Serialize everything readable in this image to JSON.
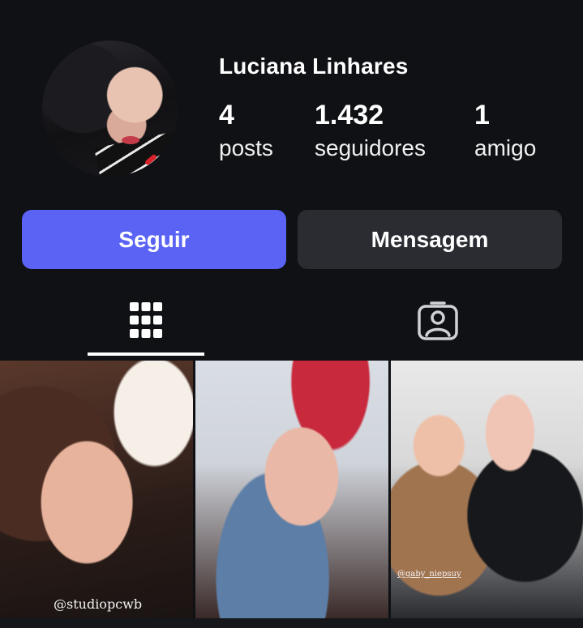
{
  "profile": {
    "name": "Luciana Linhares",
    "stats": {
      "posts": {
        "value": "4",
        "label": "posts"
      },
      "followers": {
        "value": "1.432",
        "label": "seguidores"
      },
      "friends": {
        "value": "1",
        "label": "amigo"
      }
    }
  },
  "actions": {
    "follow_label": "Seguir",
    "message_label": "Mensagem"
  },
  "tabs": [
    {
      "icon": "grid-icon",
      "active": true
    },
    {
      "icon": "tagged-person-icon",
      "active": false
    }
  ],
  "photos": [
    {
      "watermark": "@studiopcwb"
    },
    {
      "watermark": ""
    },
    {
      "watermark": "@gaby_niepsuy"
    }
  ],
  "colors": {
    "background": "#0f1115",
    "follow_button": "#5a63f4",
    "message_button": "#2a2c32",
    "text": "#ffffff"
  }
}
